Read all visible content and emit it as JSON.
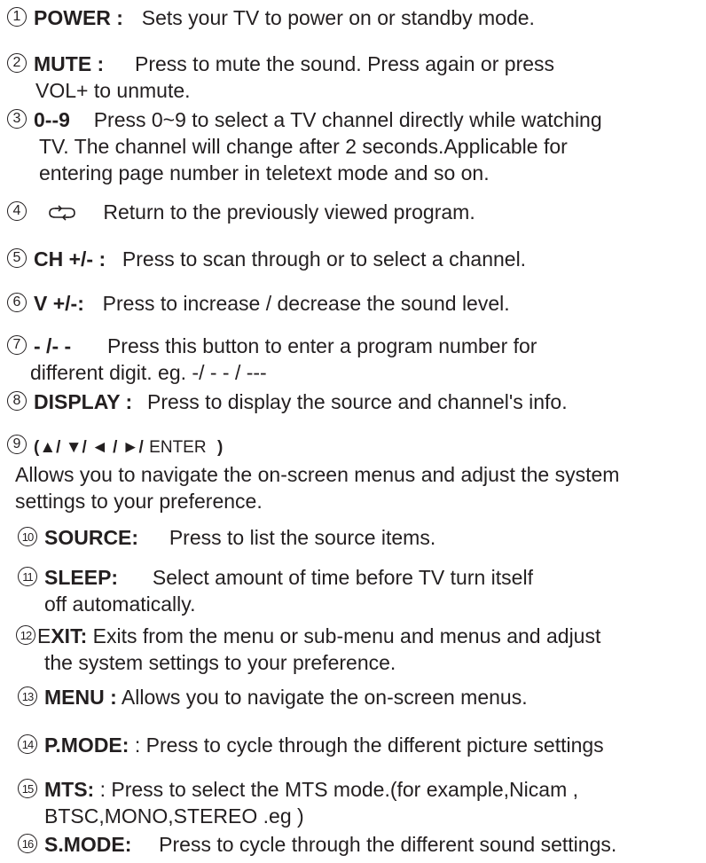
{
  "items": [
    {
      "num": "1",
      "key": "POWER :",
      "text": "Sets your TV to power on or standby mode.",
      "cont": []
    },
    {
      "num": "2",
      "key": "MUTE :",
      "text": "Press to mute the sound. Press again or press",
      "cont": [
        "VOL+ to unmute."
      ]
    },
    {
      "num": "3",
      "key": "0--9",
      "text": "Press 0~9 to select a TV channel directly while watching",
      "cont": [
        "TV. The channel will change after 2 seconds.Applicable for",
        "entering page number in teletext mode and so on."
      ]
    },
    {
      "num": "4",
      "icon": "return-arrows-icon",
      "text": "Return to the previously viewed program.",
      "cont": []
    },
    {
      "num": "5",
      "key": "CH +/- :",
      "text": "Press to scan through or to select a channel.",
      "cont": []
    },
    {
      "num": "6",
      "key": "V +/-:",
      "text": "Press to increase / decrease the sound level.",
      "cont": []
    },
    {
      "num": "7",
      "key": "- /- -",
      "text": "Press this button to enter a program number for",
      "cont": [
        "different digit. eg. -/ - - / ---"
      ]
    },
    {
      "num": "8",
      "key": "DISPLAY :",
      "text": "Press to display the source and channel's info.",
      "cont": []
    },
    {
      "num": "9",
      "key": "(▲/ ▼/ ◄ / ►/",
      "key_tail": "ENTER",
      "key_close": ")",
      "text": "",
      "cont": [
        "Allows you to navigate the on-screen menus and adjust the system",
        "settings to your preference."
      ]
    },
    {
      "num": "10",
      "key": "SOURCE:",
      "text": "Press to list the source   items.",
      "cont": []
    },
    {
      "num": "11",
      "key": "SLEEP:",
      "text": "Select amount of time before TV turn itself",
      "cont": [
        "off automatically."
      ]
    },
    {
      "num": "12",
      "key_plain": "E",
      "key": "XIT:",
      "text": "Exits from the menu or sub-menu and menus and adjust",
      "cont": [
        "the system settings to your preference."
      ]
    },
    {
      "num": "13",
      "key": "MENU :",
      "text": "Allows you to navigate the on-screen menus.",
      "cont": []
    },
    {
      "num": "14",
      "key": "P.MODE:",
      "text": ": Press to cycle through the different picture settings",
      "cont": []
    },
    {
      "num": "15",
      "key": "MTS:",
      "text": ":  Press to select the MTS mode.(for example,Nicam ,",
      "cont": [
        "BTSC,MONO,STEREO .eg )"
      ]
    },
    {
      "num": "16",
      "key": "S.MODE:",
      "text": "Press to cycle through the different sound settings.",
      "cont": []
    }
  ]
}
